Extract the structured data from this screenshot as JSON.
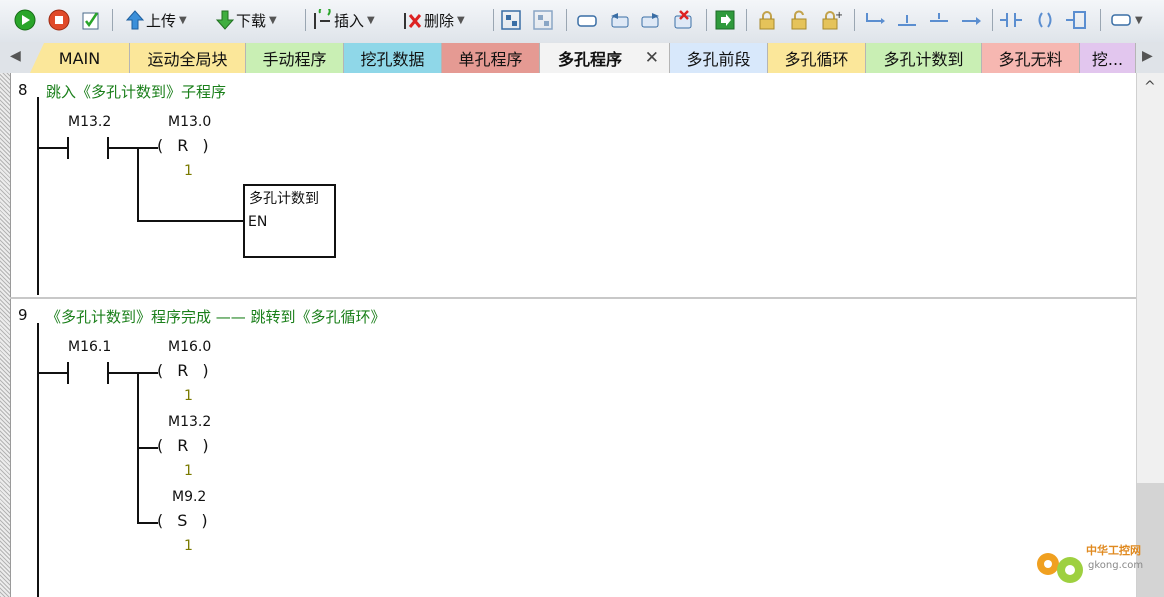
{
  "toolbar": {
    "upload_label": "上传",
    "download_label": "下载",
    "insert_label": "插入",
    "delete_label": "删除"
  },
  "tabs": [
    {
      "label": "MAIN",
      "color": "#fbe79a"
    },
    {
      "label": "运动全局块",
      "color": "#fbe79a"
    },
    {
      "label": "手动程序",
      "color": "#c9efb4"
    },
    {
      "label": "挖孔数据",
      "color": "#8fd7e8"
    },
    {
      "label": "单孔程序",
      "color": "#e59a93"
    },
    {
      "label": "多孔程序",
      "color": "#f3f3f3"
    },
    {
      "label": "多孔前段",
      "color": "#d8e8fb"
    },
    {
      "label": "多孔循环",
      "color": "#fbe79a"
    },
    {
      "label": "多孔计数到",
      "color": "#c9efb4"
    },
    {
      "label": "多孔无料",
      "color": "#f6b7b1"
    },
    {
      "label": "挖...",
      "color": "#e2c6ee"
    }
  ],
  "networks": [
    {
      "number": "8",
      "title": "跳入《多孔计数到》子程序",
      "contact": "M13.2",
      "coils": [
        {
          "address": "M13.0",
          "type": "R",
          "count": "1"
        }
      ],
      "box": {
        "name": "多孔计数到",
        "pin": "EN"
      }
    },
    {
      "number": "9",
      "title": "《多孔计数到》程序完成 —— 跳转到《多孔循环》",
      "contact": "M16.1",
      "coils": [
        {
          "address": "M16.0",
          "type": "R",
          "count": "1"
        },
        {
          "address": "M13.2",
          "type": "R",
          "count": "1"
        },
        {
          "address": "M9.2",
          "type": "S",
          "count": "1"
        }
      ]
    }
  ],
  "watermark": {
    "name": "中华工控网",
    "site": "gkong.com"
  }
}
